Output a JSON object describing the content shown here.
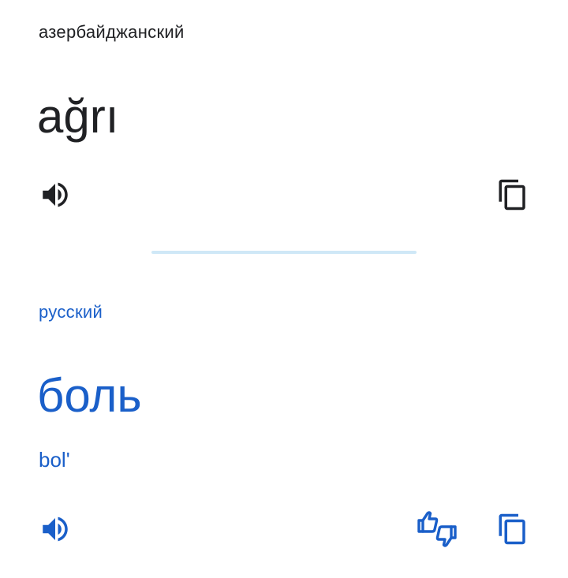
{
  "source": {
    "language": "азербайджанский",
    "text": "ağrı",
    "speak_icon": "speaker-icon",
    "copy_icon": "copy-icon"
  },
  "target": {
    "language": "русский",
    "text": "боль",
    "transliteration": "bol'",
    "speak_icon": "speaker-icon",
    "feedback_icon": "thumbs-feedback-icon",
    "copy_icon": "copy-icon"
  },
  "colors": {
    "source_text": "#202124",
    "source_icons": "#202124",
    "target_accent": "#1a5fc9",
    "divider": "#cfe8f7"
  }
}
